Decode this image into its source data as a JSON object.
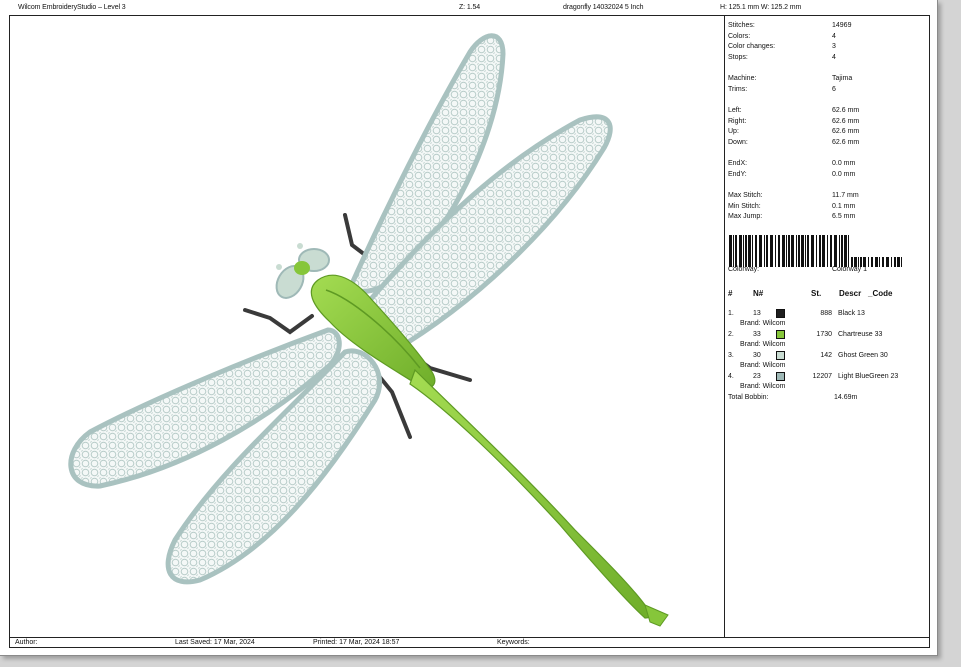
{
  "header": {
    "title": "Wilcom EmbroideryStudio – Level 3",
    "zoom": "Z: 1.54",
    "file": "dragonfly 14032024 5 Inch",
    "size": "H: 125.1 mm   W: 125.2 mm"
  },
  "stats": [
    {
      "label": "Stitches:",
      "value": "14969"
    },
    {
      "label": "Colors:",
      "value": "4"
    },
    {
      "label": "Color changes:",
      "value": "3"
    },
    {
      "label": "Stops:",
      "value": "4"
    },
    {
      "label": "Machine:",
      "value": "Tajima"
    },
    {
      "label": "Trims:",
      "value": "6"
    },
    {
      "label": "Left:",
      "value": "62.6 mm"
    },
    {
      "label": "Right:",
      "value": "62.6 mm"
    },
    {
      "label": "Up:",
      "value": "62.6 mm"
    },
    {
      "label": "Down:",
      "value": "62.6 mm"
    },
    {
      "label": "EndX:",
      "value": "0.0 mm"
    },
    {
      "label": "EndY:",
      "value": "0.0 mm"
    },
    {
      "label": "Max Stitch:",
      "value": "11.7 mm"
    },
    {
      "label": "Min Stitch:",
      "value": "0.1 mm"
    },
    {
      "label": "Max Jump:",
      "value": "6.5 mm"
    }
  ],
  "colorway": {
    "label": "Colorway:",
    "value": "Colorway 1"
  },
  "table": {
    "headers": {
      "num": "#",
      "n": "N#",
      "st": "St.",
      "descr": "Descr",
      "code": "_Code"
    },
    "rows": [
      {
        "idx": "1.",
        "n": "13",
        "color": "#1e1e1e",
        "st": "888",
        "descr": "Black 13",
        "brand": "Brand: Wilcom"
      },
      {
        "idx": "2.",
        "n": "33",
        "color": "#86c63a",
        "st": "1730",
        "descr": "Chartreuse 33",
        "brand": "Brand: Wilcom"
      },
      {
        "idx": "3.",
        "n": "30",
        "color": "#c9dcd2",
        "st": "142",
        "descr": "Ghost Green 30",
        "brand": "Brand: Wilcom"
      },
      {
        "idx": "4.",
        "n": "23",
        "color": "#9fb9b7",
        "st": "12207",
        "descr": "Light BlueGreen 23",
        "brand": "Brand: Wilcom"
      }
    ],
    "bobbin_label": "Total Bobbin:",
    "bobbin_value": "14.69m"
  },
  "footer": {
    "author": "Author:",
    "saved": "Last Saved: 17 Mar, 2024",
    "printed": "Printed: 17 Mar, 2024 18:57",
    "keywords": "Keywords:"
  },
  "colors": {
    "wing_outline": "#a9c2c0",
    "wing_lace": "#b8ccc9",
    "body": "#86c63a",
    "legs": "#3a3a3a"
  }
}
